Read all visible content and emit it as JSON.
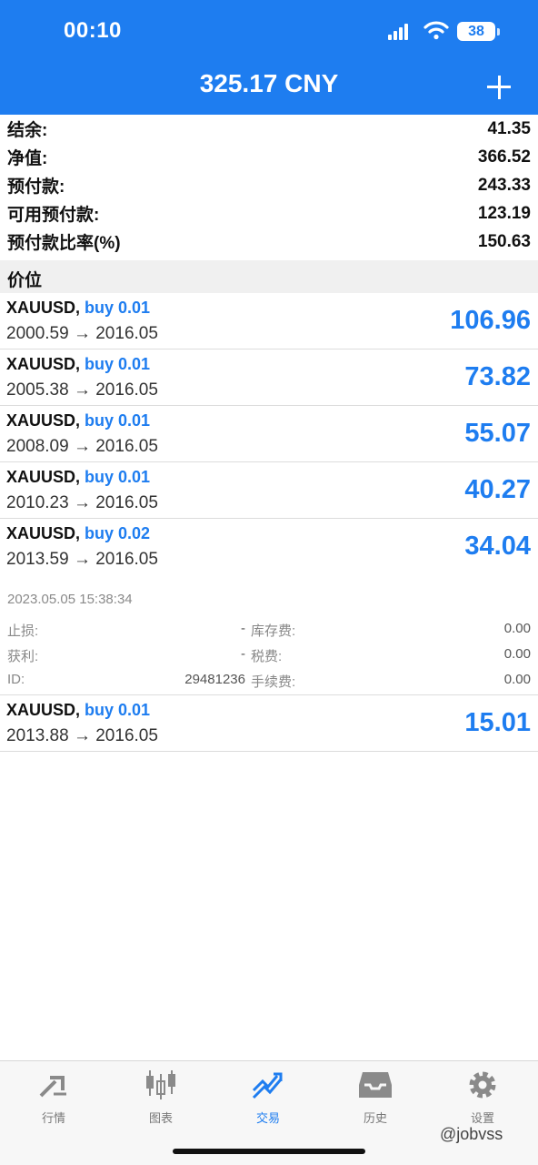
{
  "status_bar": {
    "time": "00:10",
    "battery": "38"
  },
  "header": {
    "title": "325.17 CNY",
    "add_icon": "plus-icon"
  },
  "summary": [
    {
      "label": "结余:",
      "value": "41.35"
    },
    {
      "label": "净值:",
      "value": "366.52"
    },
    {
      "label": "预付款:",
      "value": "243.33"
    },
    {
      "label": "可用预付款:",
      "value": "123.19"
    },
    {
      "label": "预付款比率(%)",
      "value": "150.63"
    }
  ],
  "section_title": "价位",
  "positions": [
    {
      "symbol": "XAUUSD,",
      "direction": "buy 0.01",
      "prices": "2000.59 → 2016.05",
      "profit": "106.96"
    },
    {
      "symbol": "XAUUSD,",
      "direction": "buy 0.01",
      "prices": "2005.38 → 2016.05",
      "profit": "73.82"
    },
    {
      "symbol": "XAUUSD,",
      "direction": "buy 0.01",
      "prices": "2008.09 → 2016.05",
      "profit": "55.07"
    },
    {
      "symbol": "XAUUSD,",
      "direction": "buy 0.01",
      "prices": "2010.23 → 2016.05",
      "profit": "40.27"
    },
    {
      "symbol": "XAUUSD,",
      "direction": "buy 0.02",
      "prices": "2013.59 → 2016.05",
      "profit": "34.04"
    },
    {
      "symbol": "XAUUSD,",
      "direction": "buy 0.01",
      "prices": "2013.88 → 2016.05",
      "profit": "15.01"
    }
  ],
  "detail": {
    "time": "2023.05.05 15:38:34",
    "rows": [
      {
        "l1": "止损:",
        "v1": "-",
        "l2": "库存费:",
        "v2": "0.00"
      },
      {
        "l1": "获利:",
        "v1": "-",
        "l2": "税费:",
        "v2": "0.00"
      },
      {
        "l1": "ID:",
        "v1": "29481236",
        "l2": "手续费:",
        "v2": "0.00"
      }
    ]
  },
  "tabs": [
    {
      "label": "行情",
      "icon": "quotes-arrows-icon",
      "active": false
    },
    {
      "label": "图表",
      "icon": "candlestick-chart-icon",
      "active": false
    },
    {
      "label": "交易",
      "icon": "trade-trend-icon",
      "active": true
    },
    {
      "label": "历史",
      "icon": "history-inbox-icon",
      "active": false
    },
    {
      "label": "设置",
      "icon": "gear-icon",
      "active": false
    }
  ],
  "colors": {
    "accent": "#1e7df0",
    "text": "#111111",
    "muted": "#888888"
  },
  "watermark": "@jobvss"
}
